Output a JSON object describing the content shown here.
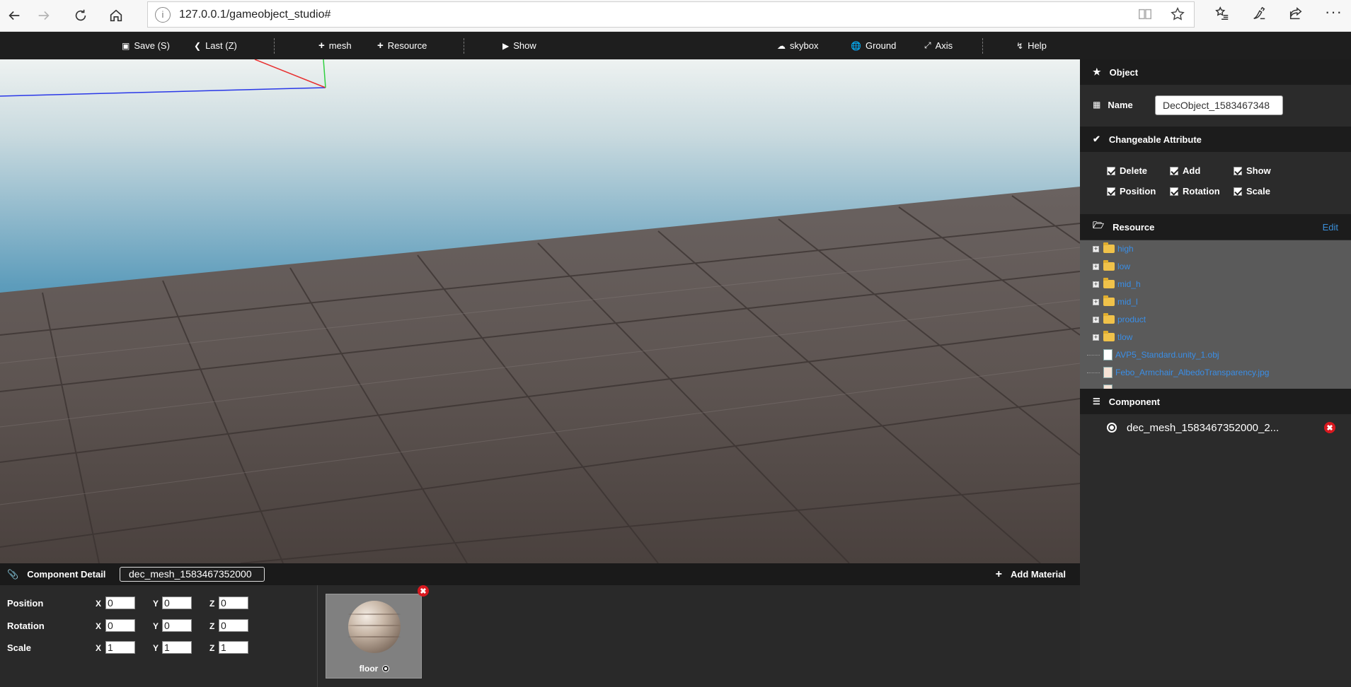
{
  "browser": {
    "url": "127.0.0.1/gameobject_studio#"
  },
  "toolbar": {
    "save": "Save (S)",
    "last": "Last (Z)",
    "mesh": "mesh",
    "resource": "Resource",
    "show": "Show",
    "skybox": "skybox",
    "ground": "Ground",
    "axis": "Axis",
    "help": "Help"
  },
  "object_panel": {
    "header": "Object",
    "name_label": "Name",
    "name_value": "DecObject_1583467348"
  },
  "attributes": {
    "header": "Changeable Attribute",
    "items": [
      "Delete",
      "Add",
      "Show",
      "Position",
      "Rotation",
      "Scale"
    ]
  },
  "resource": {
    "header": "Resource",
    "edit": "Edit",
    "folders": [
      "high",
      "low",
      "mid_h",
      "mid_l",
      "product",
      "tlow"
    ],
    "files": [
      "AVP5_Standard.unity_1.obj",
      "Febo_Armchair_AlbedoTransparency.jpg"
    ]
  },
  "component": {
    "header": "Component",
    "items": [
      "dec_mesh_1583467352000_2..."
    ]
  },
  "component_detail": {
    "title": "Component Detail",
    "name_value": "dec_mesh_1583467352000",
    "add_material": "Add Material",
    "axes": {
      "x": "X",
      "y": "Y",
      "z": "Z"
    },
    "rows": [
      {
        "label": "Position",
        "x": "0",
        "y": "0",
        "z": "0"
      },
      {
        "label": "Rotation",
        "x": "0",
        "y": "0",
        "z": "0"
      },
      {
        "label": "Scale",
        "x": "1",
        "y": "1",
        "z": "1"
      }
    ],
    "material": "floor"
  }
}
